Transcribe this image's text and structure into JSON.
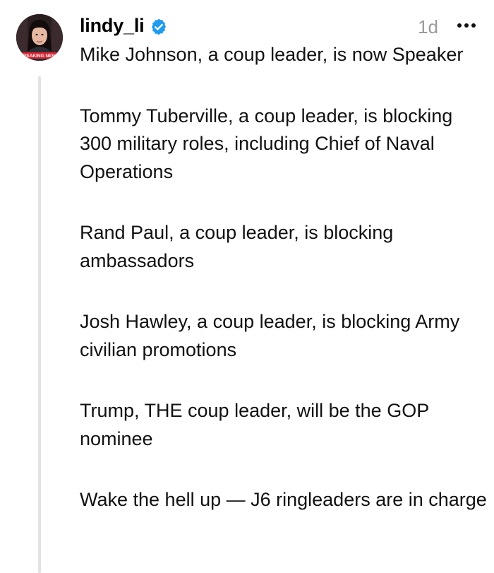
{
  "post": {
    "username": "lindy_li",
    "timestamp": "1d",
    "avatar_overlay_text": "BREAKING NEWS",
    "paragraphs": [
      "Mike Johnson, a coup leader, is now Speaker",
      "Tommy Tuberville, a coup leader, is blocking 300 military roles, including Chief of Naval Operations",
      "Rand Paul, a coup leader, is blocking ambassadors",
      "Josh Hawley, a coup leader, is blocking Army civilian promotions",
      "Trump, THE coup leader, will be the GOP nominee",
      "Wake the hell up — J6 ringleaders are in charge"
    ]
  },
  "icons": {
    "verified": "verified-badge-icon",
    "more": "more-options-icon"
  },
  "colors": {
    "verified_blue": "#1d9bf0",
    "timestamp_gray": "#9a9a9a",
    "thread_line": "#e2e2e2",
    "badge_red": "#d9232f"
  }
}
